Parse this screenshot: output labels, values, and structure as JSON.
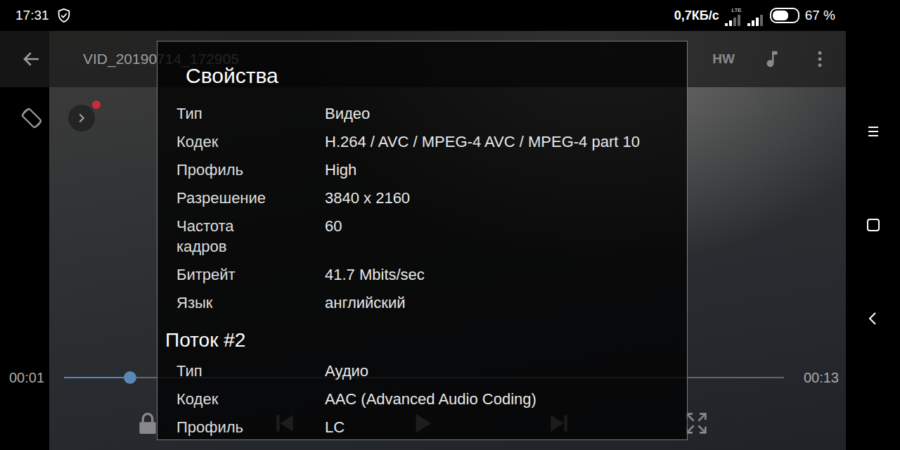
{
  "status_bar": {
    "time": "17:31",
    "net_speed": "0,7КБ/с",
    "network_type": "LTE",
    "signals": [
      {
        "level": 0.5
      },
      {
        "level": 0.75
      }
    ],
    "battery": "67 %",
    "battery_level": 0.67
  },
  "player": {
    "title": "VID_20190714_172905",
    "decoder": "HW",
    "position": "00:01",
    "duration": "00:13",
    "progress": 0.092,
    "menu_badge": true
  },
  "dialog": {
    "title": "Свойства",
    "sections": [
      {
        "rows": [
          {
            "label": "Тип",
            "value": "Видео"
          },
          {
            "label": "Кодек",
            "value": "H.264 / AVC / MPEG-4 AVC / MPEG-4 part 10"
          },
          {
            "label": "Профиль",
            "value": "High"
          },
          {
            "label": "Разрешение",
            "value": "3840 x 2160"
          },
          {
            "label": "Частота кадров",
            "value": "60"
          },
          {
            "label": "Битрейт",
            "value": "41.7 Mbits/sec"
          },
          {
            "label": "Язык",
            "value": "английский"
          }
        ]
      },
      {
        "heading": "Поток #2",
        "rows": [
          {
            "label": "Тип",
            "value": "Аудио"
          },
          {
            "label": "Кодек",
            "value": "AAC (Advanced Audio Coding)"
          },
          {
            "label": "Профиль",
            "value": "LC"
          }
        ]
      }
    ]
  }
}
